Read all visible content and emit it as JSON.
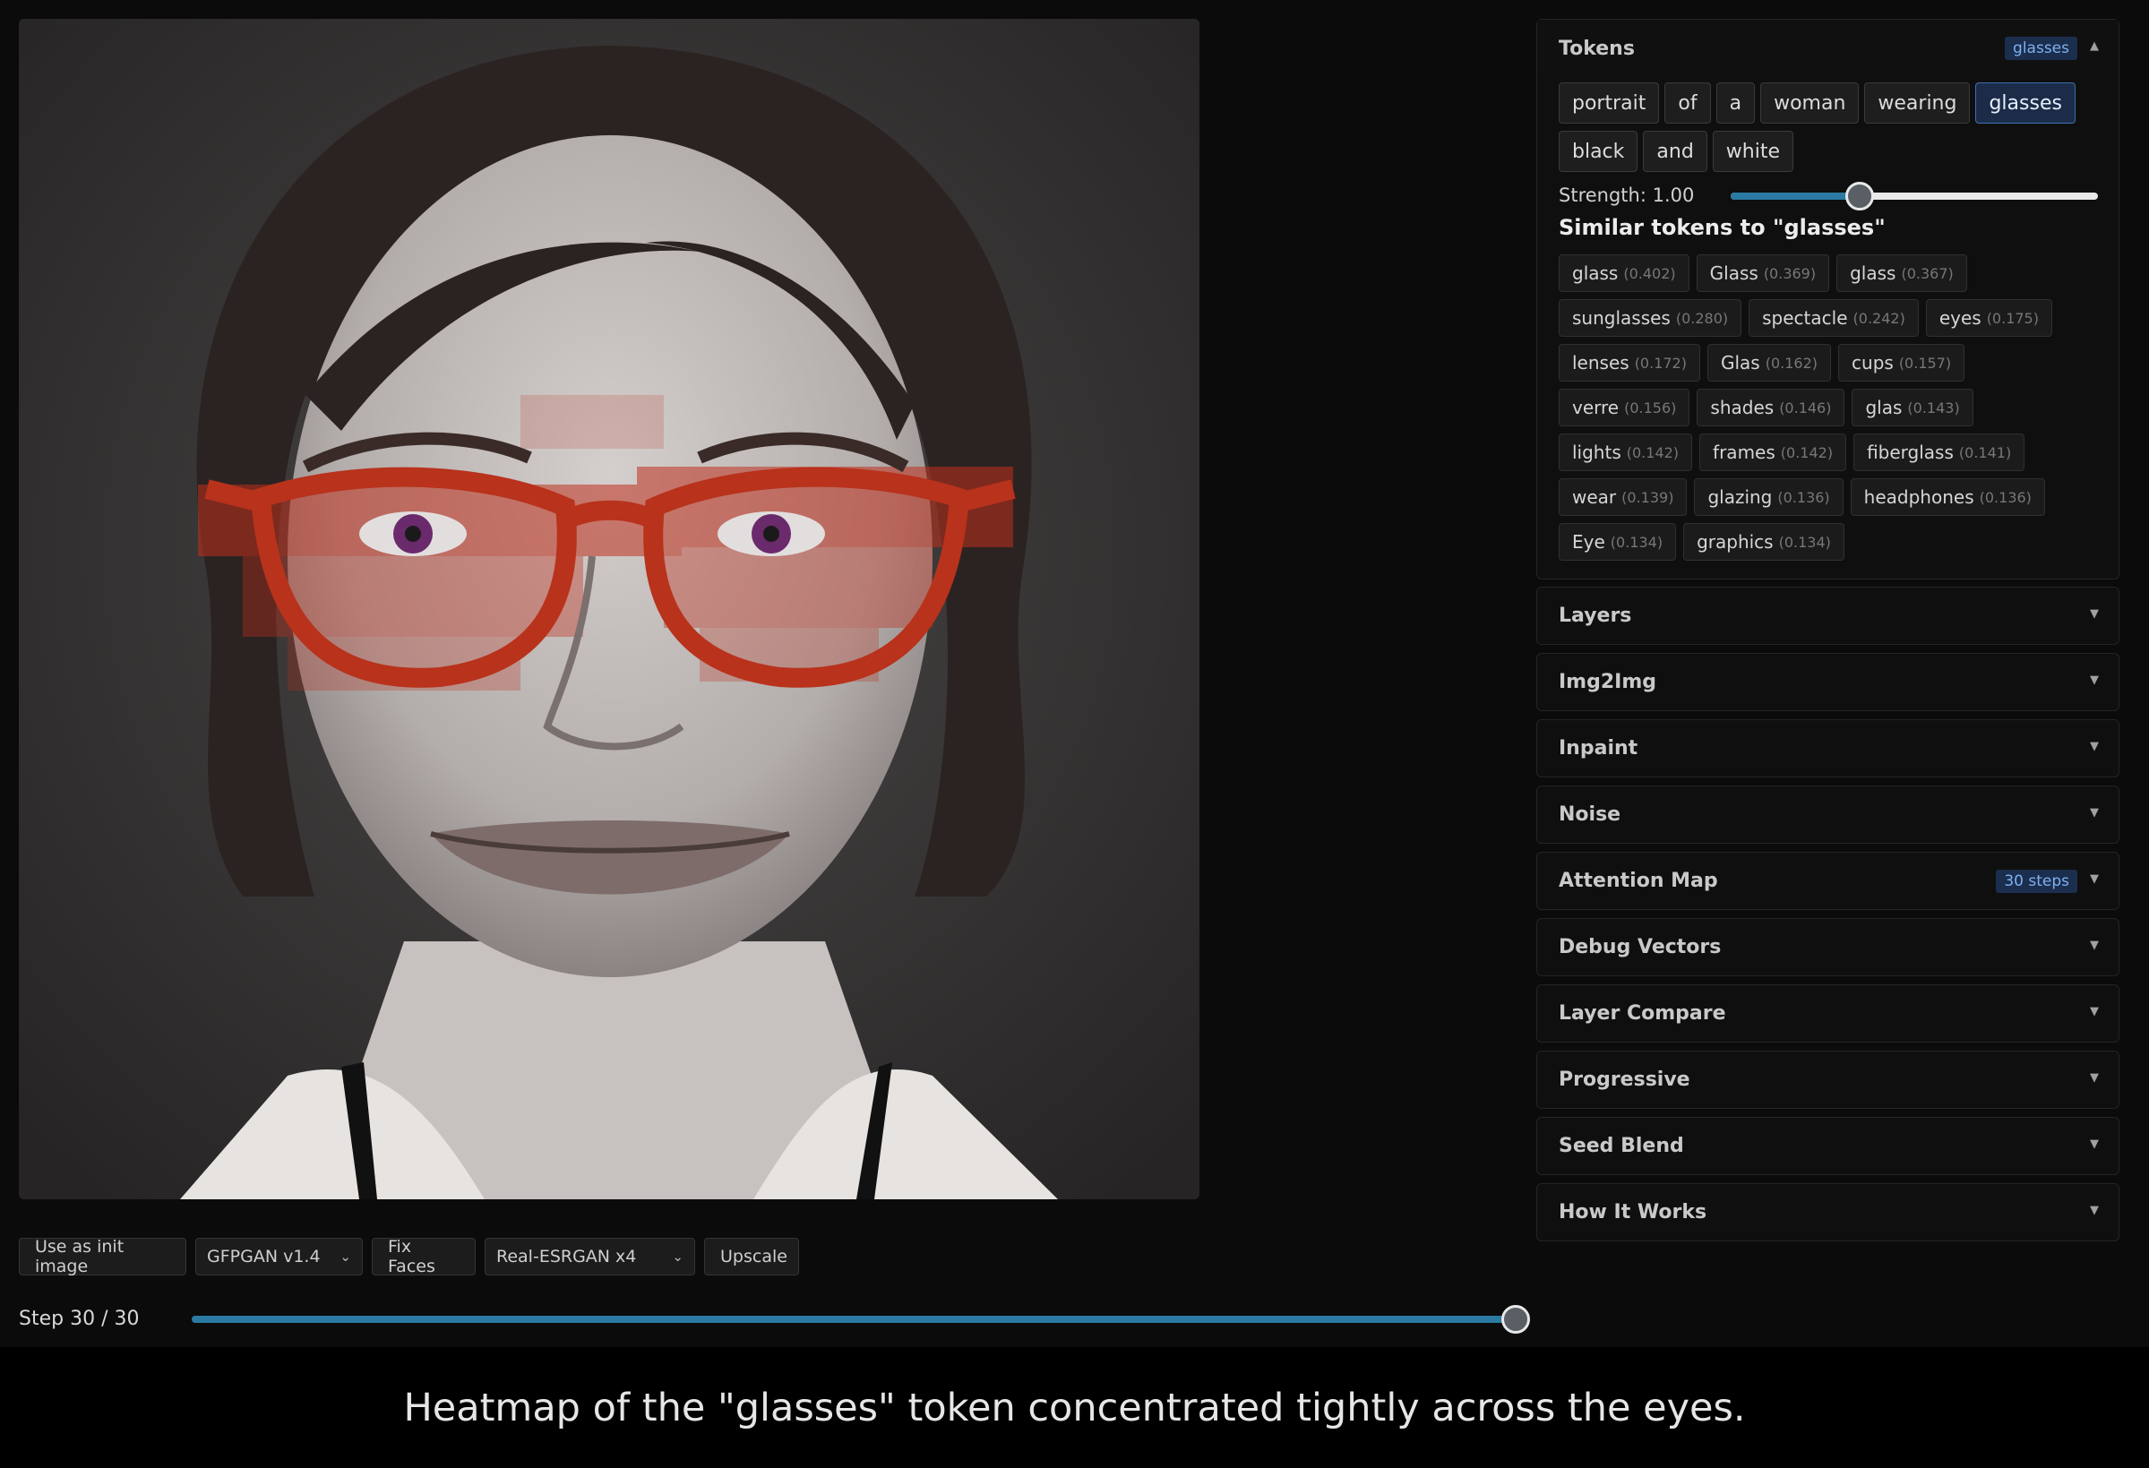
{
  "image": {
    "subject": "portrait-photo"
  },
  "actions": {
    "init_label": "Use as init image",
    "face_model": "GFPGAN v1.4",
    "fix_faces_label": "Fix Faces",
    "upscaler": "Real-ESRGAN x4",
    "upscale_label": "Upscale"
  },
  "step": {
    "label": "Step 30 / 30",
    "value": 30,
    "max": 30
  },
  "tokens_panel": {
    "title": "Tokens",
    "badge": "glasses",
    "tokens": [
      "portrait",
      "of",
      "a",
      "woman",
      "wearing",
      "glasses",
      "black",
      "and",
      "white"
    ],
    "selected_index": 5,
    "strength_label": "Strength: 1.00",
    "strength_fraction": 0.35,
    "similar_title": "Similar tokens to \"glasses\"",
    "similar": [
      {
        "word": "glass",
        "score": "(0.402)"
      },
      {
        "word": "Glass",
        "score": "(0.369)"
      },
      {
        "word": "glass",
        "score": "(0.367)"
      },
      {
        "word": "sunglasses",
        "score": "(0.280)"
      },
      {
        "word": "spectacle",
        "score": "(0.242)"
      },
      {
        "word": "eyes",
        "score": "(0.175)"
      },
      {
        "word": "lenses",
        "score": "(0.172)"
      },
      {
        "word": "Glas",
        "score": "(0.162)"
      },
      {
        "word": "cups",
        "score": "(0.157)"
      },
      {
        "word": "verre",
        "score": "(0.156)"
      },
      {
        "word": "shades",
        "score": "(0.146)"
      },
      {
        "word": "glas",
        "score": "(0.143)"
      },
      {
        "word": "lights",
        "score": "(0.142)"
      },
      {
        "word": "frames",
        "score": "(0.142)"
      },
      {
        "word": "fiberglass",
        "score": "(0.141)"
      },
      {
        "word": "wear",
        "score": "(0.139)"
      },
      {
        "word": "glazing",
        "score": "(0.136)"
      },
      {
        "word": "headphones",
        "score": "(0.136)"
      },
      {
        "word": "Eye",
        "score": "(0.134)"
      },
      {
        "word": "graphics",
        "score": "(0.134)"
      }
    ]
  },
  "panels": [
    {
      "title": "Layers",
      "badge": ""
    },
    {
      "title": "Img2Img",
      "badge": ""
    },
    {
      "title": "Inpaint",
      "badge": ""
    },
    {
      "title": "Noise",
      "badge": ""
    },
    {
      "title": "Attention Map",
      "badge": "30 steps"
    },
    {
      "title": "Debug Vectors",
      "badge": ""
    },
    {
      "title": "Layer Compare",
      "badge": ""
    },
    {
      "title": "Progressive",
      "badge": ""
    },
    {
      "title": "Seed Blend",
      "badge": ""
    },
    {
      "title": "How It Works",
      "badge": ""
    }
  ],
  "caption": "Heatmap of the \"glasses\" token concentrated tightly across the eyes.",
  "colors": {
    "accent": "#2b7aa3",
    "heat": "#c0301e",
    "badge_bg": "#1b2e4e",
    "badge_text": "#7fb0ee"
  }
}
